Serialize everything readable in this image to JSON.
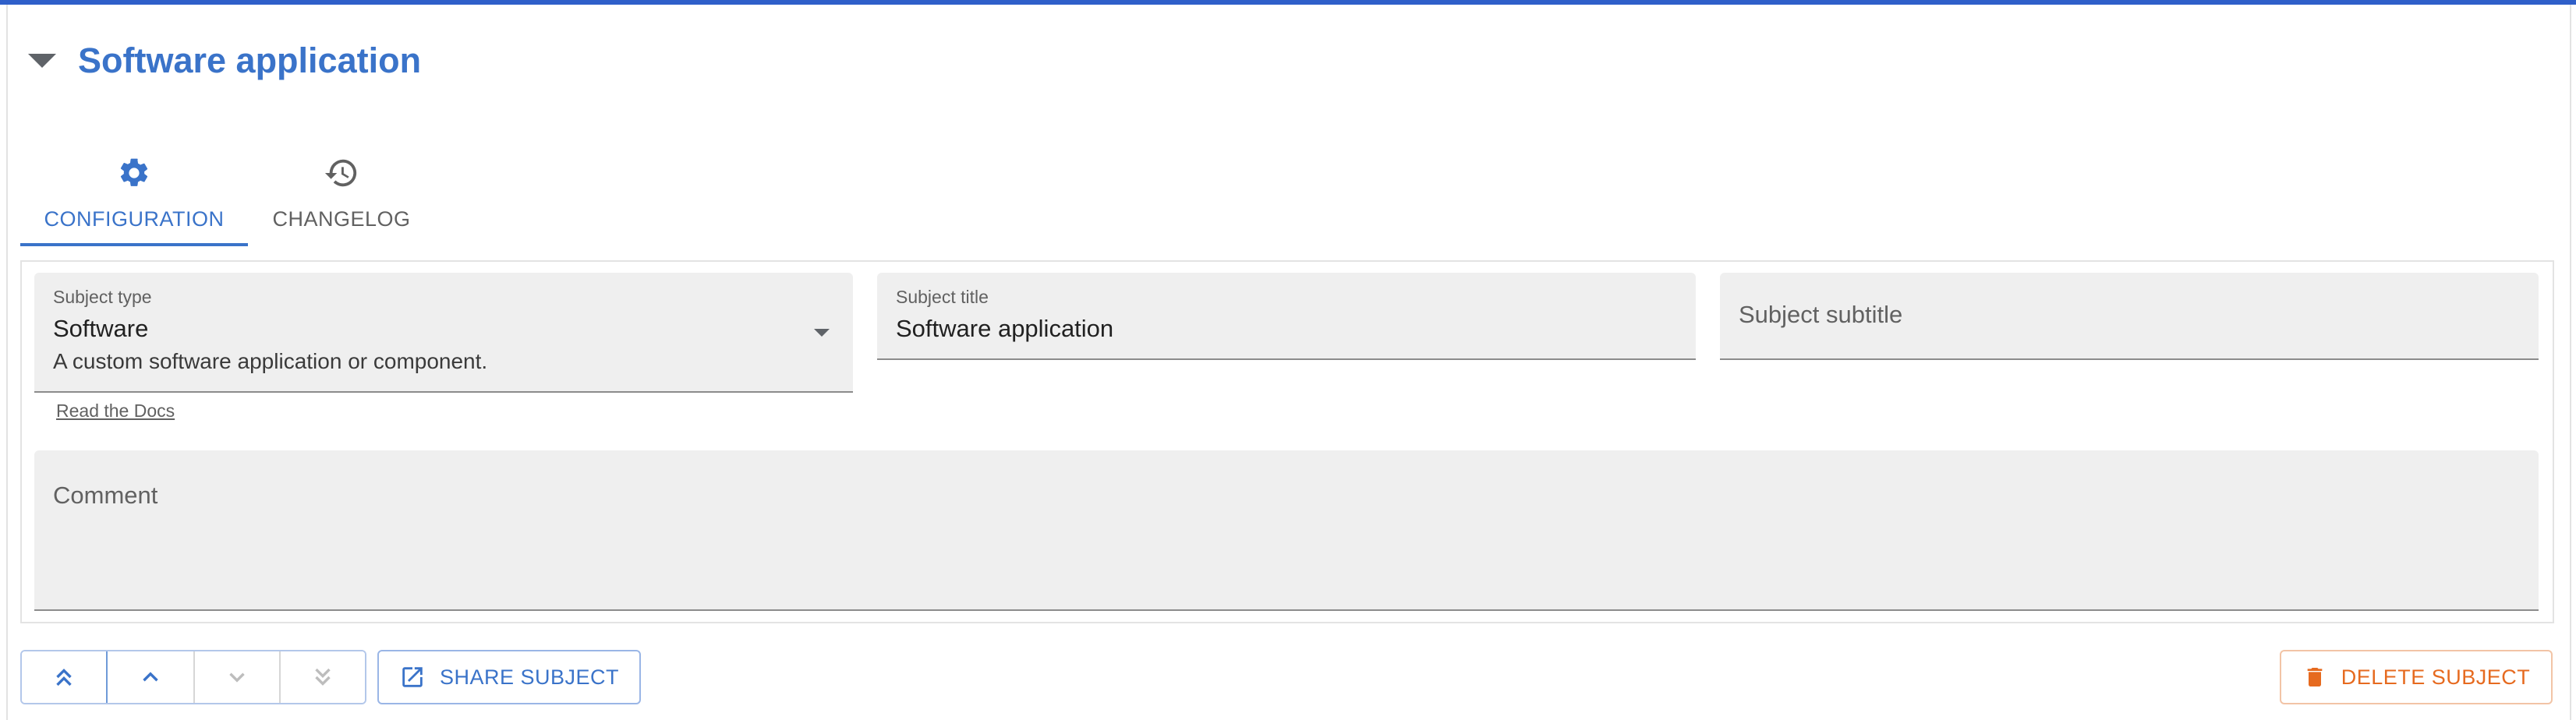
{
  "header": {
    "title": "Software application"
  },
  "tabs": [
    {
      "label": "CONFIGURATION",
      "icon": "gear-icon",
      "active": true
    },
    {
      "label": "CHANGELOG",
      "icon": "history-icon",
      "active": false
    }
  ],
  "form": {
    "subject_type": {
      "label": "Subject type",
      "value": "Software",
      "description": "A custom software application or component."
    },
    "docs_link": "Read the Docs",
    "subject_title": {
      "label": "Subject title",
      "value": "Software application"
    },
    "subject_subtitle": {
      "placeholder": "Subject subtitle"
    },
    "comment": {
      "placeholder": "Comment"
    }
  },
  "actions": {
    "move_buttons": [
      {
        "icon": "double-chevron-up-icon",
        "enabled": true
      },
      {
        "icon": "chevron-up-icon",
        "enabled": true
      },
      {
        "icon": "chevron-down-icon",
        "enabled": false
      },
      {
        "icon": "double-chevron-down-icon",
        "enabled": false
      }
    ],
    "share_label": "SHARE SUBJECT",
    "delete_label": "DELETE SUBJECT"
  },
  "colors": {
    "accent": "#3a73c9",
    "danger": "#e66a1f",
    "top_bar": "#2f5fc9"
  }
}
